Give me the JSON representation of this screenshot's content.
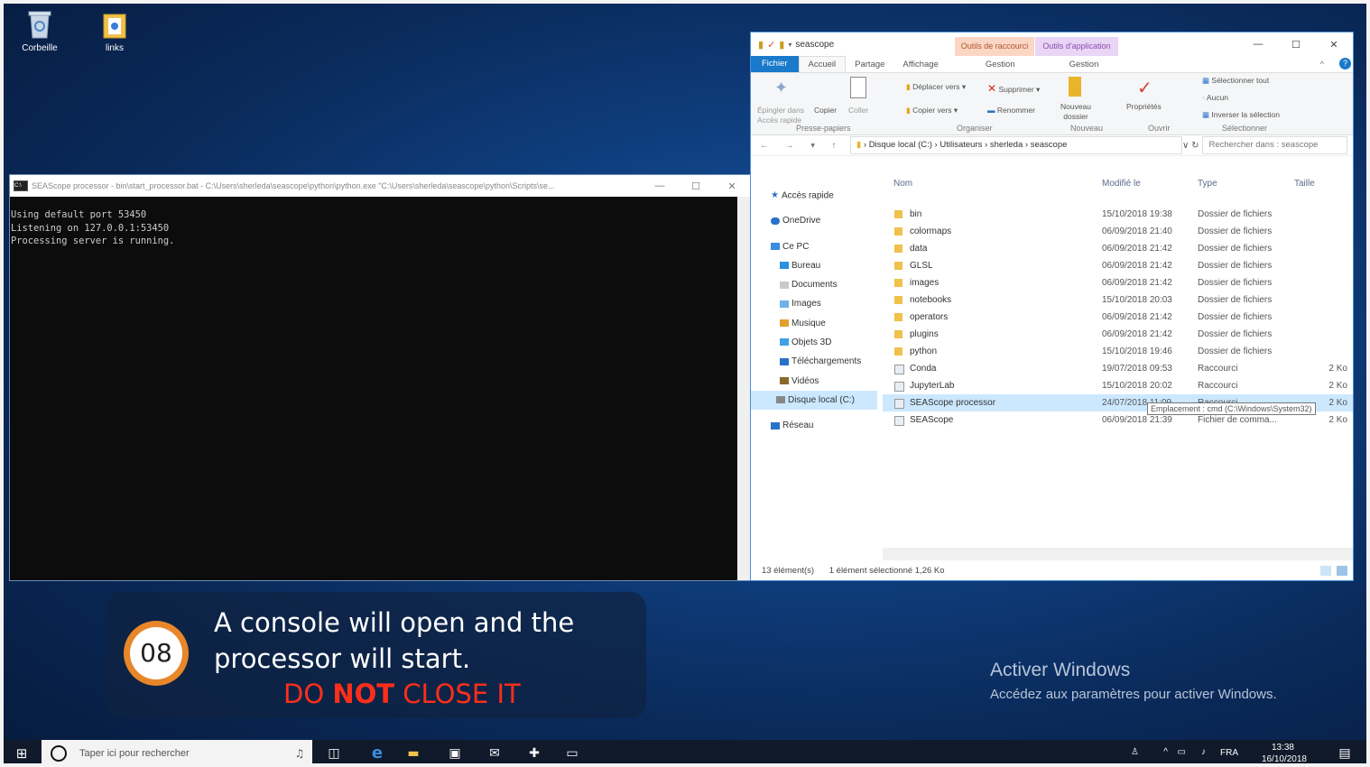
{
  "desktop": {
    "icons": [
      {
        "label": "Corbeille"
      },
      {
        "label": "links"
      }
    ]
  },
  "console": {
    "title": "SEAScope processor - bin\\start_processor.bat - C:\\Users\\sherleda\\seascope\\python\\python.exe  \"C:\\Users\\sherleda\\seascope\\python\\Scripts\\se...",
    "lines": [
      "Using default port 53450",
      "Listening on 127.0.0.1:53450",
      "Processing server is running."
    ]
  },
  "explorer": {
    "window_title": "seascope",
    "context_tabs": [
      "Outils de raccourci",
      "Outils d'application"
    ],
    "tabs": [
      "Fichier",
      "Accueil",
      "Partage",
      "Affichage",
      "Gestion",
      "Gestion"
    ],
    "ribbon": {
      "pin_label": "Épingler dans Accès rapide",
      "copy": "Copier",
      "paste": "Coller",
      "clipboard_group": "Presse-papiers",
      "move_to": "Déplacer vers",
      "copy_to": "Copier vers",
      "delete": "Supprimer",
      "rename": "Renommer",
      "organize_group": "Organiser",
      "new_folder": "Nouveau dossier",
      "new_group": "Nouveau",
      "properties": "Propriétés",
      "open_group": "Ouvrir",
      "select_all": "Sélectionner tout",
      "select_none": "Aucun",
      "invert_selection": "Inverser la sélection",
      "select_group": "Sélectionner"
    },
    "path": [
      "Disque local (C:)",
      "Utilisateurs",
      "sherleda",
      "seascope"
    ],
    "search_placeholder": "Rechercher dans : seascope",
    "nav": [
      "Accès rapide",
      "OneDrive",
      "Ce PC",
      "Bureau",
      "Documents",
      "Images",
      "Musique",
      "Objets 3D",
      "Téléchargements",
      "Vidéos",
      "Disque local (C:)",
      "Réseau"
    ],
    "columns": [
      "Nom",
      "Modifié le",
      "Type",
      "Taille"
    ],
    "files": [
      {
        "name": "bin",
        "date": "15/10/2018 19:38",
        "type": "Dossier de fichiers",
        "size": ""
      },
      {
        "name": "colormaps",
        "date": "06/09/2018 21:40",
        "type": "Dossier de fichiers",
        "size": ""
      },
      {
        "name": "data",
        "date": "06/09/2018 21:42",
        "type": "Dossier de fichiers",
        "size": ""
      },
      {
        "name": "GLSL",
        "date": "06/09/2018 21:42",
        "type": "Dossier de fichiers",
        "size": ""
      },
      {
        "name": "images",
        "date": "06/09/2018 21:42",
        "type": "Dossier de fichiers",
        "size": ""
      },
      {
        "name": "notebooks",
        "date": "15/10/2018 20:03",
        "type": "Dossier de fichiers",
        "size": ""
      },
      {
        "name": "operators",
        "date": "06/09/2018 21:42",
        "type": "Dossier de fichiers",
        "size": ""
      },
      {
        "name": "plugins",
        "date": "06/09/2018 21:42",
        "type": "Dossier de fichiers",
        "size": ""
      },
      {
        "name": "python",
        "date": "15/10/2018 19:46",
        "type": "Dossier de fichiers",
        "size": ""
      },
      {
        "name": "Conda",
        "date": "19/07/2018 09:53",
        "type": "Raccourci",
        "size": "2 Ko"
      },
      {
        "name": "JupyterLab",
        "date": "15/10/2018 20:02",
        "type": "Raccourci",
        "size": "2 Ko"
      },
      {
        "name": "SEAScope processor",
        "date": "24/07/2018 11:09",
        "type": "Raccourci",
        "size": "2 Ko"
      },
      {
        "name": "SEAScope",
        "date": "06/09/2018 21:39",
        "type": "Fichier de comma...",
        "size": "2 Ko"
      }
    ],
    "tooltip": "Emplacement : cmd (C:\\Windows\\System32)",
    "status_count": "13 élément(s)",
    "status_selected": "1 élément sélectionné  1,26 Ko"
  },
  "caption": {
    "step": "08",
    "line1": "A console will open and the",
    "line2": "processor will start.",
    "warn_pre": "DO ",
    "warn_bold": "NOT",
    "warn_post": " CLOSE IT"
  },
  "activation": {
    "title": "Activer Windows",
    "subtitle": "Accédez aux paramètres pour activer Windows."
  },
  "taskbar": {
    "search_placeholder": "Taper ici pour rechercher",
    "lang": "FRA",
    "time": "13:38",
    "date": "16/10/2018"
  }
}
